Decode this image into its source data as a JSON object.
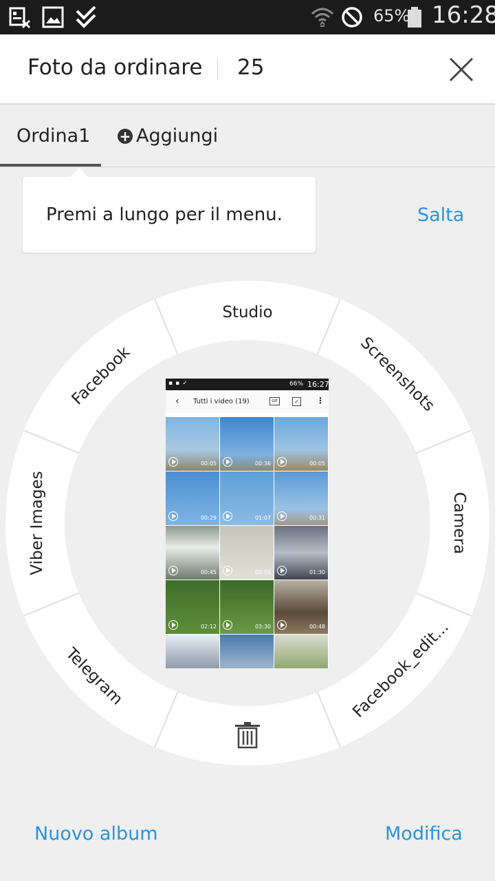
{
  "statusbar": {
    "battery_percent": "65%",
    "time": "16:28",
    "icons": [
      "contact-card-icon",
      "image-icon",
      "checkmark-icon",
      "wifi-icon",
      "blocked-icon",
      "battery-icon"
    ]
  },
  "header": {
    "title": "Foto da ordinare",
    "count": "25",
    "close_icon": "close-icon"
  },
  "tabs": {
    "items": [
      {
        "label": "Ordina1",
        "active": true
      },
      {
        "label": "Aggiungi",
        "icon": "add-circle-icon"
      }
    ]
  },
  "tooltip": {
    "text": "Premi a lungo per il menu."
  },
  "skip_label": "Salta",
  "wheel": {
    "segments": [
      {
        "label": "Studio"
      },
      {
        "label": "Screenshots"
      },
      {
        "label": "Camera"
      },
      {
        "label": "Facebook_edit..."
      },
      {
        "label": "",
        "icon": "trash-icon"
      },
      {
        "label": "Telegram"
      },
      {
        "label": "Viber Images"
      },
      {
        "label": "Facebook"
      }
    ]
  },
  "preview": {
    "status_battery": "66%",
    "status_time": "16:27",
    "title": "Tutti i video (19)",
    "icons": [
      "back-icon",
      "gif-icon",
      "check-icon",
      "more-icon"
    ],
    "durations": [
      "00:05",
      "00:36",
      "00:05",
      "00:29",
      "01:07",
      "00:31",
      "00:45",
      "00:56",
      "01:30",
      "02:12",
      "03:30",
      "00:48"
    ]
  },
  "footer": {
    "new_album": "Nuovo album",
    "edit": "Modifica"
  },
  "colors": {
    "accent": "#2a93e0",
    "statusbar": "#1b1b1b",
    "background": "#efefef"
  }
}
